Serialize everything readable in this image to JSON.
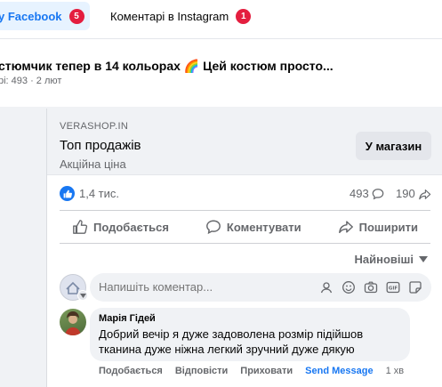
{
  "tabs": [
    {
      "label": "y Facebook",
      "badge": "5"
    },
    {
      "label": "Коментарі в Instagram",
      "badge": "1"
    }
  ],
  "post": {
    "title": "стюмчик тепер в 14 кольорах 🌈 Цей костюм просто...",
    "meta": "рі: 493 · 2 лют"
  },
  "link_preview": {
    "domain": "VERASHOP.IN",
    "title": "Топ продажів",
    "subtitle": "Акційна ціна",
    "button": "У магазин"
  },
  "stats": {
    "likes": "1,4 тис.",
    "comments": "493",
    "shares": "190"
  },
  "actions": {
    "like": "Подобається",
    "comment": "Коментувати",
    "share": "Поширити"
  },
  "sort": {
    "label": "Найновіші"
  },
  "composer": {
    "placeholder": "Напишіть коментар..."
  },
  "comment": {
    "author": "Марія Гідей",
    "text": "Добрий вечір я дуже задоволена розмір підійшов тканина дуже ніжна легкий зручний дуже дякую",
    "like": "Подобається",
    "reply": "Відповісти",
    "hide": "Приховати",
    "send": "Send Message",
    "time": "1 хв"
  },
  "colors": {
    "accent": "#1877f2",
    "badge": "#e41e3f",
    "muted": "#65676b"
  }
}
